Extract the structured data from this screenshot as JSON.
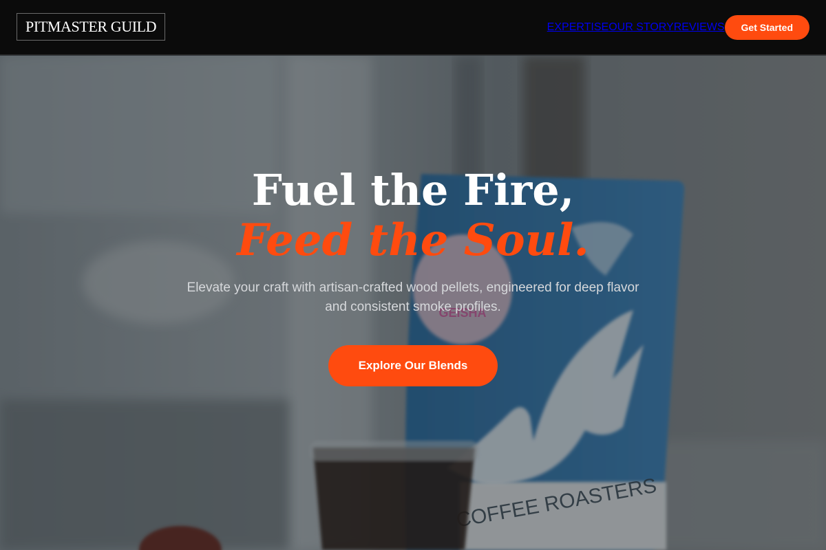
{
  "brand": {
    "name": "PITMASTER GUILD",
    "accent": "#ff4b0f"
  },
  "nav": {
    "items": [
      {
        "label": "EXPERTISE"
      },
      {
        "label": "OUR STORY"
      },
      {
        "label": "REVIEWS"
      }
    ],
    "cta_label": "Get Started"
  },
  "hero": {
    "headline_line1": "Fuel the Fire,",
    "headline_line2": "Feed the Soul.",
    "subtext": "Elevate your craft with artisan-crafted wood pellets, engineered for deep flavor and consistent smoke profiles.",
    "cta_label": "Explore Our Blends",
    "background": {
      "bag_print": "COFFEE ROASTERS",
      "sticker_text": "GEISHA"
    }
  }
}
